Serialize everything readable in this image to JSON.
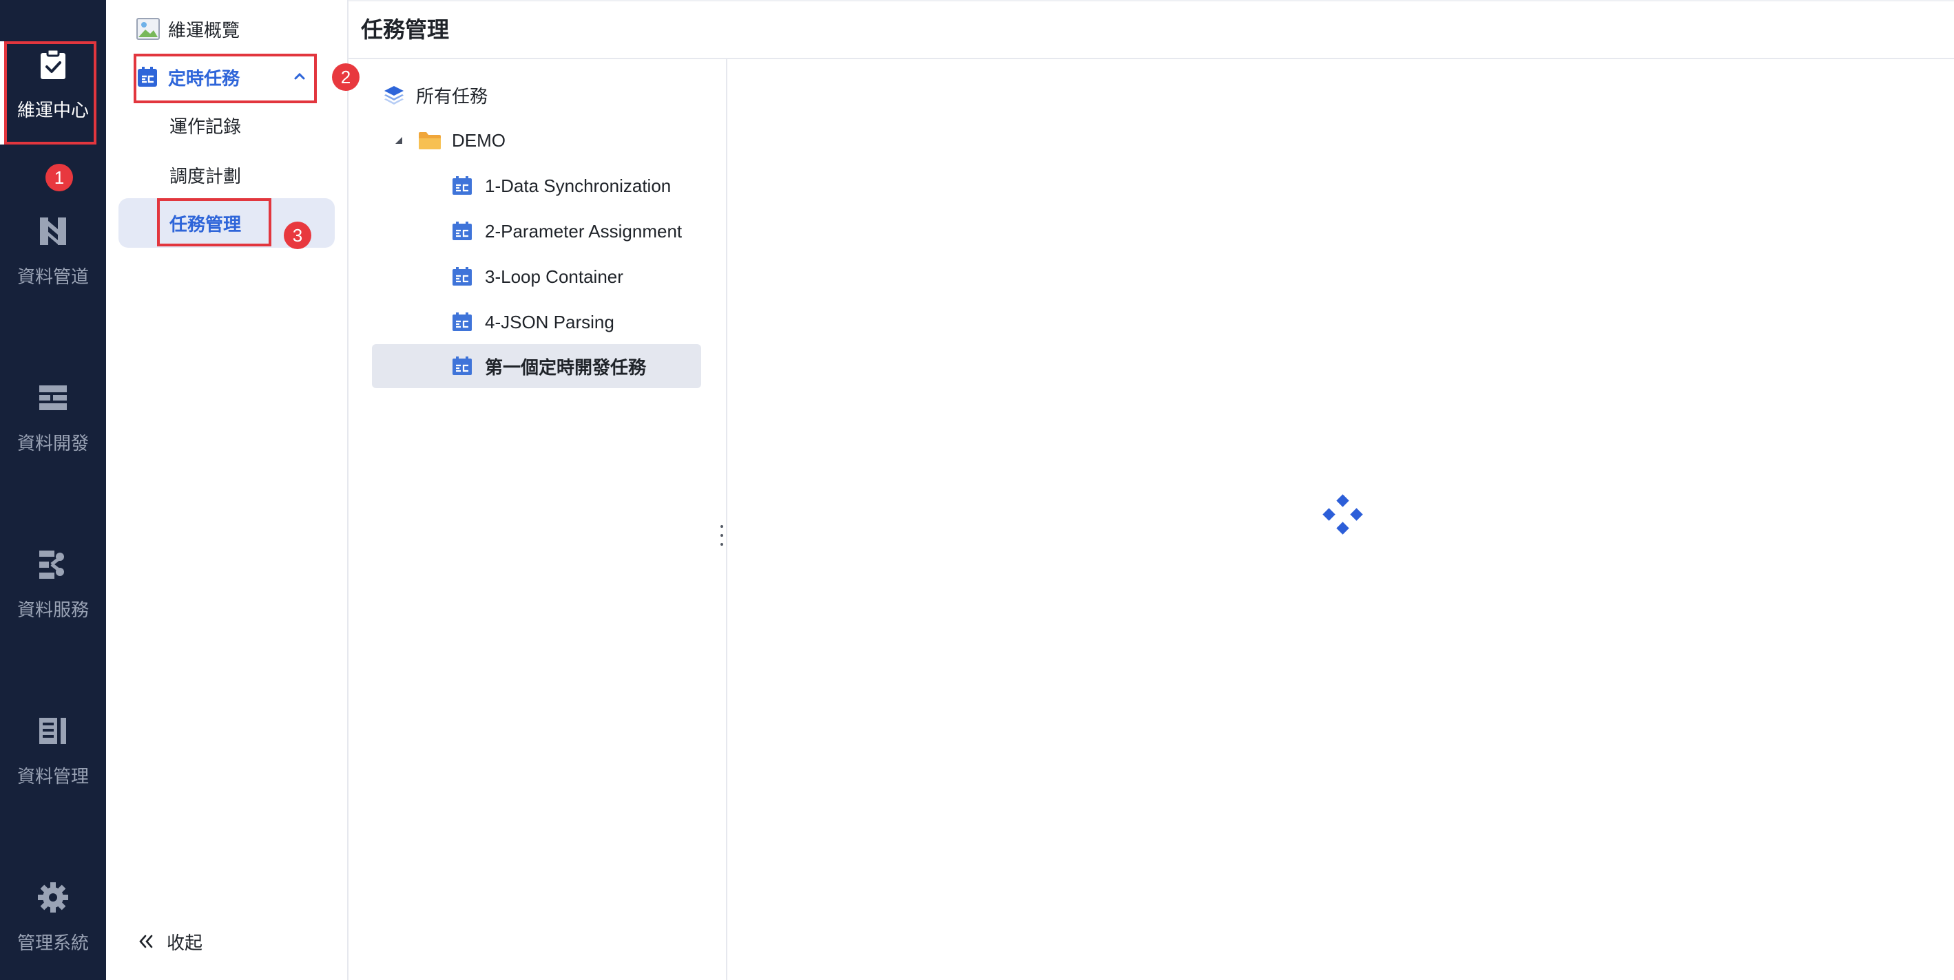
{
  "rail": {
    "items": [
      {
        "label": "維運中心",
        "icon": "clipboard-check-icon",
        "active": true
      },
      {
        "label": "資料管道",
        "icon": "pipeline-icon"
      },
      {
        "label": "資料開發",
        "icon": "data-dev-icon"
      },
      {
        "label": "資料服務",
        "icon": "data-service-icon"
      },
      {
        "label": "資料管理",
        "icon": "data-manage-icon"
      },
      {
        "label": "管理系統",
        "icon": "gear-icon"
      }
    ]
  },
  "menu": {
    "overview": "維運概覽",
    "scheduled_tasks": "定時任務",
    "sub_items": [
      "運作記錄",
      "調度計劃",
      "任務管理"
    ],
    "collapse": "收起"
  },
  "header": {
    "title": "任務管理"
  },
  "tree": {
    "root": "所有任務",
    "folder": "DEMO",
    "tasks": [
      "1-Data Synchronization",
      "2-Parameter Assignment",
      "3-Loop Container",
      "4-JSON Parsing",
      "第一個定時開發任務"
    ]
  },
  "annotations": {
    "badges": [
      "1",
      "2",
      "3"
    ]
  },
  "colors": {
    "rail_bg": "#16213a",
    "accent": "#2e65d9",
    "highlight": "#e2363e",
    "selected_bg": "#e4e9f6"
  }
}
